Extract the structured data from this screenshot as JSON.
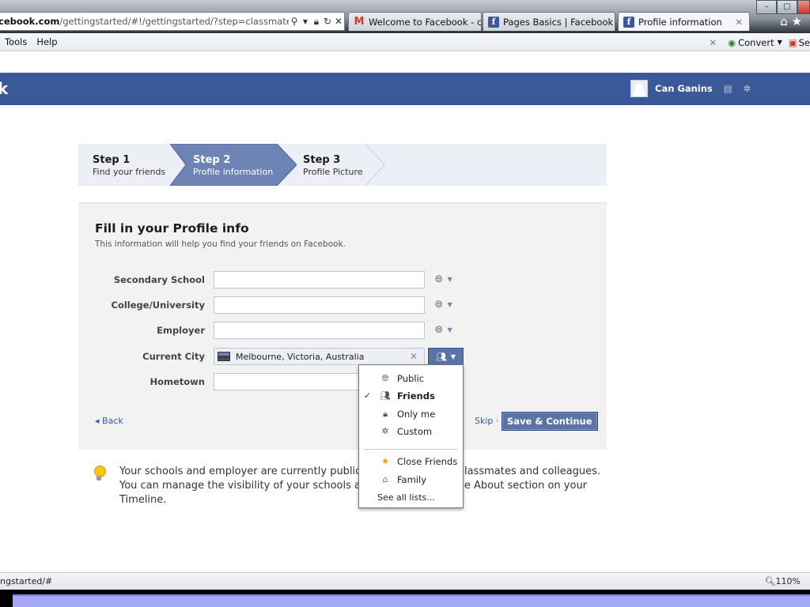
{
  "browser": {
    "address": {
      "host": "cebook.com",
      "path": "/gettingstarted/#!/gettingstarted/?step=classmates_cov"
    },
    "tabs": [
      {
        "label": "Welcome to Facebook - c...",
        "icon": "gmail-icon"
      },
      {
        "label": "Pages Basics | Facebook ...",
        "icon": "facebook-icon"
      },
      {
        "label": "Profile information",
        "icon": "facebook-icon"
      }
    ],
    "menu": [
      "Tools",
      "Help"
    ],
    "toolbar_right": {
      "convert": "Convert",
      "select_frag": "Se"
    },
    "status_url": "ngstarted/#",
    "zoom": "110%"
  },
  "fb": {
    "user_name": "Can Ganins"
  },
  "steps": [
    {
      "title": "Step 1",
      "sub": "Find your friends"
    },
    {
      "title": "Step 2",
      "sub": "Profile information"
    },
    {
      "title": "Step 3",
      "sub": "Profile Picture"
    }
  ],
  "form": {
    "title": "Fill in your Profile info",
    "subtitle": "This information will help you find your friends on Facebook.",
    "fields": [
      {
        "label": "Secondary School",
        "value": ""
      },
      {
        "label": "College/University",
        "value": ""
      },
      {
        "label": "Employer",
        "value": ""
      },
      {
        "label": "Current City",
        "value": "Melbourne, Victoria, Australia"
      },
      {
        "label": "Hometown",
        "value": ""
      }
    ],
    "back": "Back",
    "skip": "Skip",
    "save": "Save & Continue"
  },
  "audience_menu": {
    "items": [
      {
        "label": "Public",
        "icon": "globe-icon",
        "selected": false
      },
      {
        "label": "Friends",
        "icon": "friends-icon",
        "selected": true
      },
      {
        "label": "Only me",
        "icon": "lock-icon",
        "selected": false
      },
      {
        "label": "Custom",
        "icon": "gear-icon",
        "selected": false
      },
      {
        "label": "Close Friends",
        "icon": "star-list-icon",
        "selected": false
      },
      {
        "label": "Family",
        "icon": "house-icon",
        "selected": false
      }
    ],
    "see_all": "See all lists..."
  },
  "tip": {
    "line1_a": "Your schools and employer are currently public to",
    "line1_b": "h classmates and colleagues.",
    "line2_a": "You can manage the visibility of your schools and",
    "line2_b": "the About section on your",
    "line3": "Timeline."
  },
  "colors": {
    "fb_blue": "#3b5998",
    "button_blue": "#5b74a8",
    "link_blue": "#3b5998"
  }
}
